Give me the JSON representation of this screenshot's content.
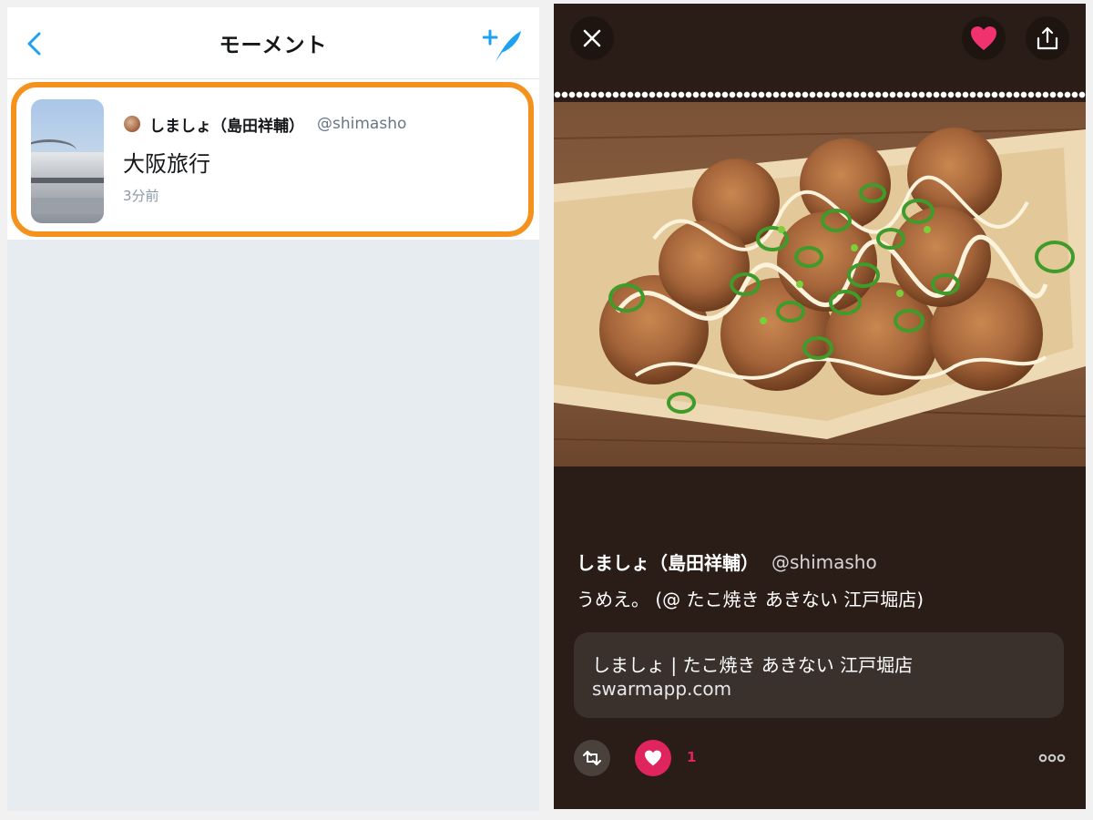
{
  "moments_screen": {
    "title": "モーメント",
    "moment": {
      "author_name": "しましょ（島田祥輔）",
      "author_handle": "@shimasho",
      "title": "大阪旅行",
      "time": "3分前"
    }
  },
  "tweet_screen": {
    "tweet": {
      "author_name": "しましょ（島田祥輔）",
      "author_handle": "@shimasho",
      "text": "うめえ。 (@ たこ焼き あきない 江戸堀店)"
    },
    "link_card": {
      "title": "しましょ | たこ焼き あきない 江戸堀店",
      "domain": "swarmapp.com"
    },
    "like_count": "1"
  },
  "colors": {
    "accent_blue": "#1da1f2",
    "highlight_orange": "#f5921e",
    "like_pink": "#e0245e",
    "dark_bg": "#2a1d18"
  },
  "icons": [
    "back-chevron-icon",
    "compose-moment-icon",
    "close-icon",
    "heart-icon",
    "share-icon",
    "retweet-icon",
    "more-icon"
  ]
}
